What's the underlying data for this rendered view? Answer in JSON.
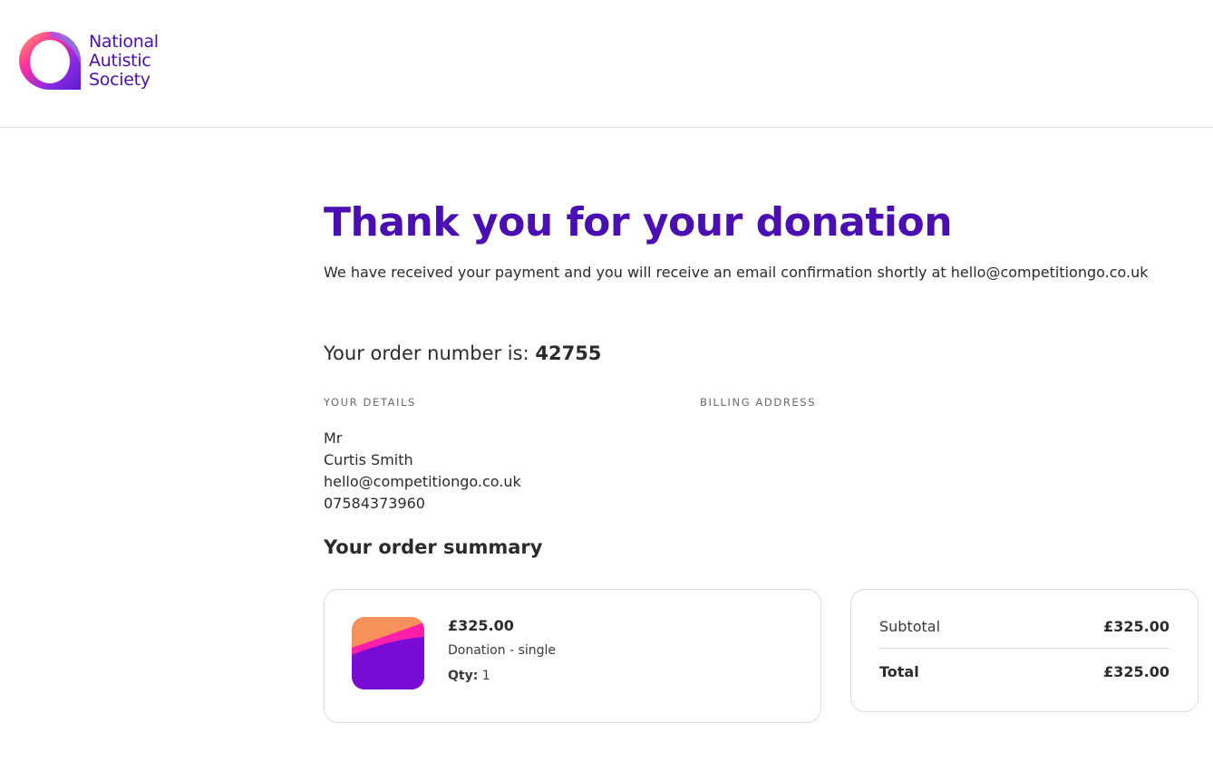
{
  "brand": {
    "name_lines": [
      "National",
      "Autistic",
      "Society"
    ],
    "color": "#4a0fb2"
  },
  "page": {
    "title": "Thank you for your donation",
    "confirmation": "We have received your payment and you will receive an email confirmation shortly at hello@competitiongo.co.uk"
  },
  "order": {
    "number_label": "Your order number is:",
    "number": "42755"
  },
  "details": {
    "your_details_label": "YOUR DETAILS",
    "billing_address_label": "BILLING ADDRESS",
    "lines": [
      "Mr",
      "Curtis Smith",
      "hello@competitiongo.co.uk",
      "07584373960"
    ]
  },
  "summary": {
    "title": "Your order summary",
    "item": {
      "price": "£325.00",
      "description": "Donation - single",
      "qty_label": "Qty:",
      "qty": "1",
      "icon": "donation-gradient-icon"
    },
    "totals": {
      "subtotal_label": "Subtotal",
      "subtotal_value": "£325.00",
      "total_label": "Total",
      "total_value": "£325.00"
    }
  },
  "colors": {
    "accent": "#4a0fb2",
    "thumb_orange": "#f7905a",
    "thumb_pink": "#ff1fa8",
    "thumb_purple": "#7a0ad6"
  }
}
